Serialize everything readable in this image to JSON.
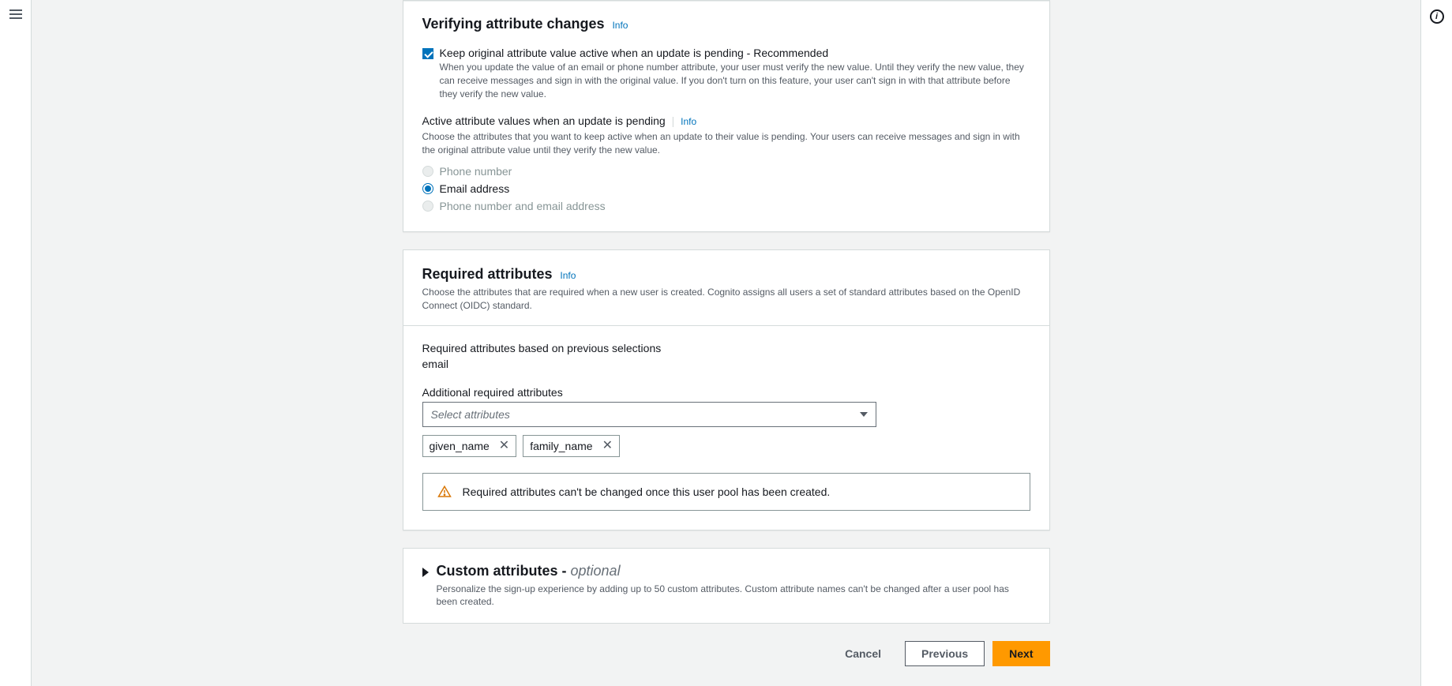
{
  "verifying": {
    "title": "Verifying attribute changes",
    "info": "Info",
    "checkbox_label": "Keep original attribute value active when an update is pending - Recommended",
    "checkbox_help": "When you update the value of an email or phone number attribute, your user must verify the new value. Until they verify the new value, they can receive messages and sign in with the original value. If you don't turn on this feature, your user can't sign in with that attribute before they verify the new value.",
    "active_heading": "Active attribute values when an update is pending",
    "active_info": "Info",
    "active_desc": "Choose the attributes that you want to keep active when an update to their value is pending. Your users can receive messages and sign in with the original attribute value until they verify the new value.",
    "radios": {
      "phone": "Phone number",
      "email": "Email address",
      "both": "Phone number and email address"
    }
  },
  "required": {
    "title": "Required attributes",
    "info": "Info",
    "desc": "Choose the attributes that are required when a new user is created. Cognito assigns all users a set of standard attributes based on the OpenID Connect (OIDC) standard.",
    "based_label": "Required attributes based on previous selections",
    "based_value": "email",
    "additional_label": "Additional required attributes",
    "select_placeholder": "Select attributes",
    "tokens": [
      "given_name",
      "family_name"
    ],
    "alert": "Required attributes can't be changed once this user pool has been created."
  },
  "custom": {
    "title": "Custom attributes - ",
    "optional": "optional",
    "desc": "Personalize the sign-up experience by adding up to 50 custom attributes. Custom attribute names can't be changed after a user pool has been created."
  },
  "actions": {
    "cancel": "Cancel",
    "previous": "Previous",
    "next": "Next"
  }
}
